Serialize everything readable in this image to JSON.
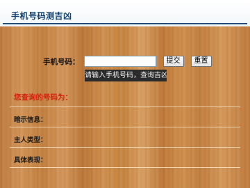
{
  "header": {
    "title": "手机号码测吉凶"
  },
  "form": {
    "phone_label": "手机号码：",
    "phone_value": "",
    "submit_label": "提交",
    "reset_label": "重置"
  },
  "tooltip": {
    "text": "请输入手机号码，查询吉凶"
  },
  "result": {
    "title": "您查询的号码为：",
    "fields": {
      "hint_label": "暗示信息：",
      "owner_type_label": "主人类型：",
      "detail_label": "具体表现："
    }
  }
}
